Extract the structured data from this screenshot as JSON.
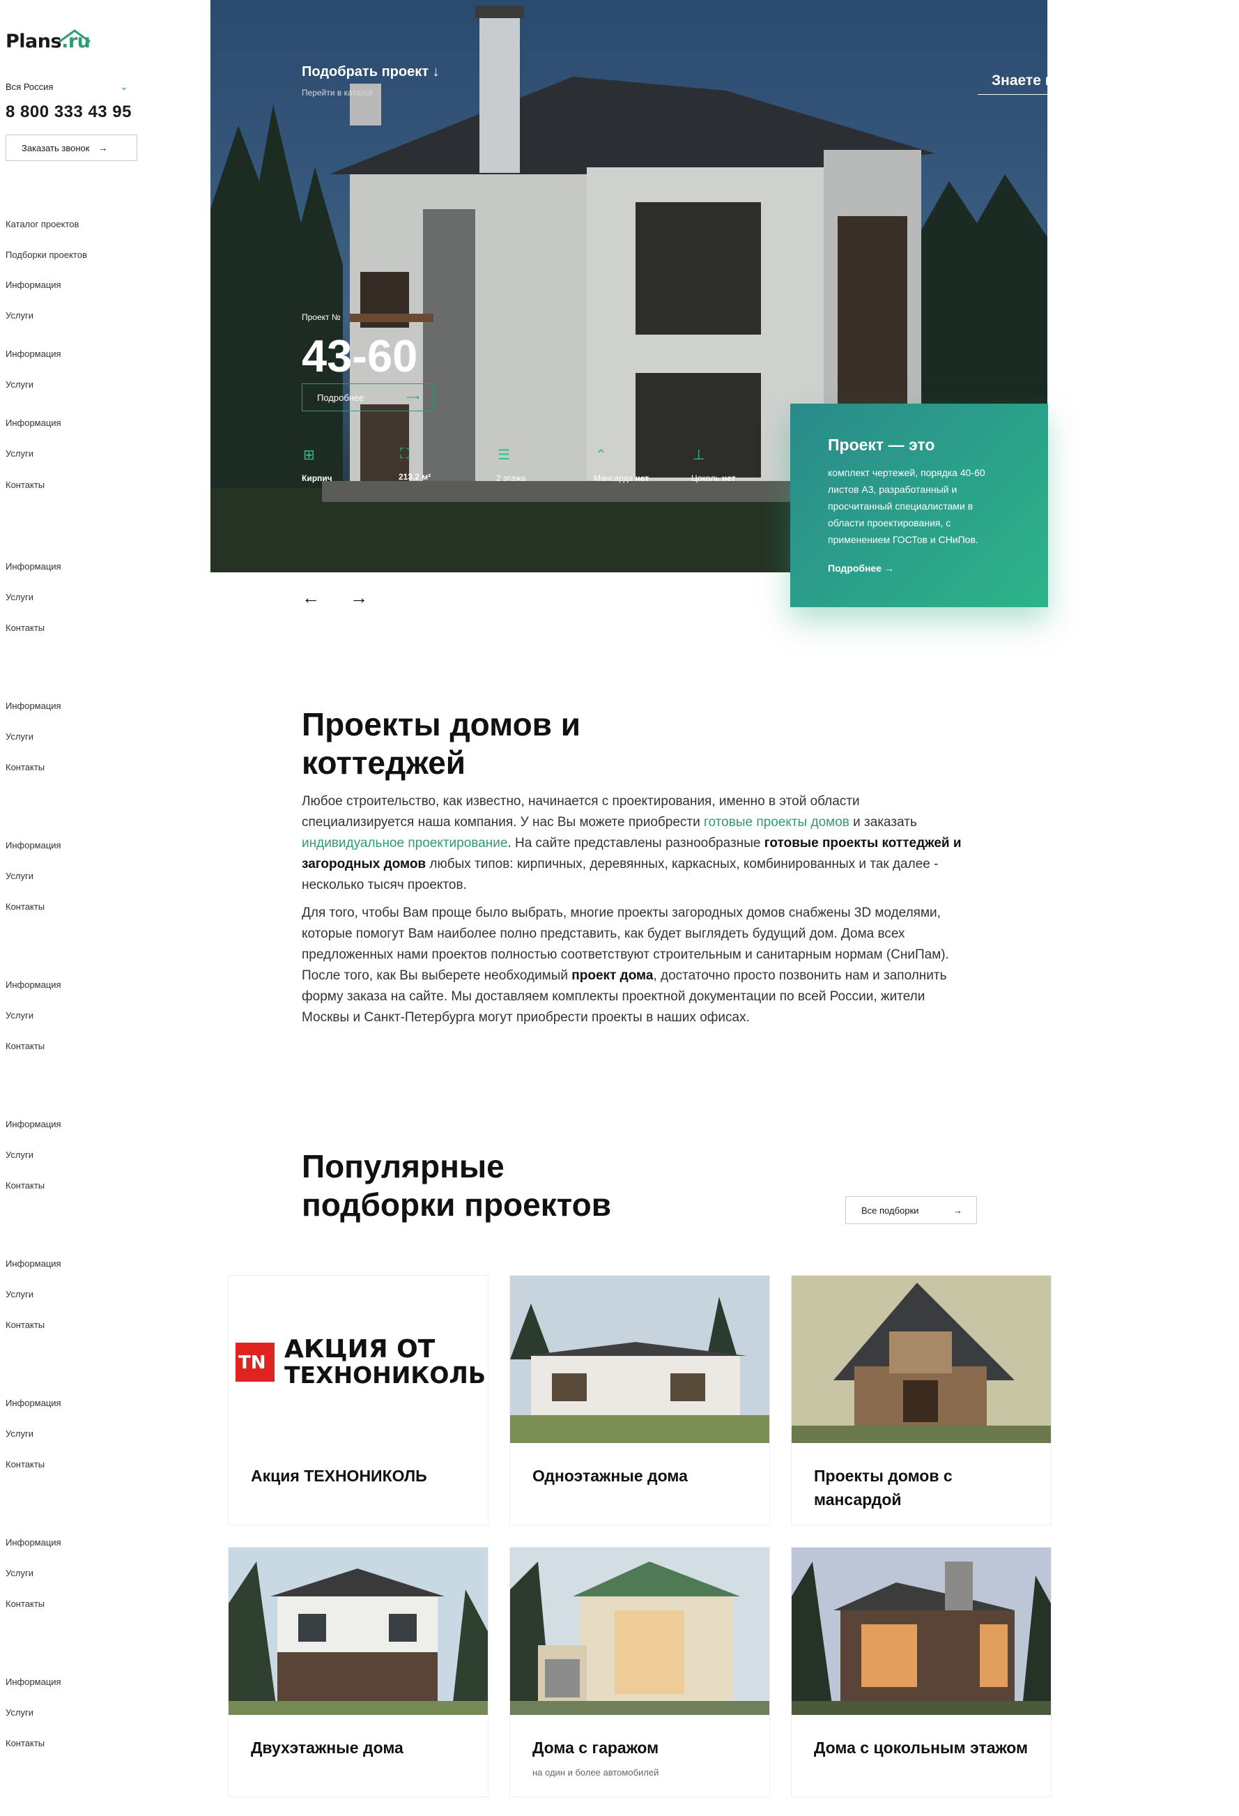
{
  "logo": {
    "text_main": "Plans",
    "text_dot": ".ru"
  },
  "sidebar": {
    "region": "Вся Россия",
    "phone": "8 800 333 43 95",
    "callback_label": "Заказать звонок",
    "nav": [
      "Каталог проектов",
      "Подборки проектов",
      "Информация",
      "Услуги",
      "Информация",
      "Услуги",
      "Информация",
      "Услуги",
      "Контакты",
      "Информация",
      "Услуги",
      "Контакты",
      "Информация",
      "Услуги",
      "Контакты",
      "Информация",
      "Услуги",
      "Контакты",
      "Информация",
      "Услуги",
      "Контакты",
      "Информация",
      "Услуги",
      "Контакты",
      "Информация",
      "Услуги",
      "Контакты",
      "Информация",
      "Услуги",
      "Контакты",
      "Информация",
      "Услуги",
      "Контакты",
      "Информация",
      "Услуги",
      "Контакты"
    ]
  },
  "hero": {
    "pick_title": "Подобрать проект",
    "pick_arrow": "↓",
    "pick_sub": "Перейти в каталог",
    "search_placeholder": "Знаете код проекта?",
    "project_label": "Проект №",
    "project_number": "43-60",
    "more_label": "Подробнее",
    "features": [
      {
        "icon": "wall-icon",
        "label": "Кирпич",
        "value": ""
      },
      {
        "icon": "area-icon",
        "label": "213.2 м²",
        "value": ""
      },
      {
        "icon": "floors-icon",
        "label": "2 этажа",
        "value": ""
      },
      {
        "icon": "attic-icon",
        "label": "Мансарда",
        "value": "нет"
      },
      {
        "icon": "basement-icon",
        "label": "Цоколь",
        "value": "нет"
      }
    ],
    "card": {
      "title": "Проект — это",
      "text": "комплект чертежей, порядка 40-60 листов А3, разработанный и просчитанный специалистами в области проектирования, с применением ГОСТов и СНиПов.",
      "more_label": "Подробнее"
    }
  },
  "about": {
    "title_line1": "Проекты домов и",
    "title_line2": "коттеджей",
    "p1_a": "Любое строительство, как известно, начинается с проектирования, именно в этой области специализируется наша компания. У нас Вы можете приобрести ",
    "p1_link1": "готовые проекты домов",
    "p1_b": " и заказать ",
    "p1_link2": "индивидуальное проектирование",
    "p1_c": ". На сайте представлены разнообразные ",
    "p1_bold": "готовые проекты коттеджей и загородных домов",
    "p1_d": " любых типов: кирпичных, деревянных, каркасных, комбинированных и так далее - несколько тысяч проектов.",
    "p2_a": "Для того, чтобы Вам проще было выбрать, многие проекты загородных домов снабжены 3D моделями, которые помогут Вам наиболее полно представить, как будет выглядеть будущий дом. Дома всех предложенных нами проектов полностью соответствуют строительным и санитарным нормам (СниПам). После того, как Вы выберете необходимый ",
    "p2_bold": "проект дома",
    "p2_b": ", достаточно просто позвонить нам и заполнить форму заказа на сайте. Мы доставляем комплекты проектной документации по всей России, жители Москвы и Санкт-Петербурга могут приобрести проекты в наших офисах."
  },
  "popular": {
    "title_line1": "Популярные",
    "title_line2": "подборки проектов",
    "all_label": "Все подборки",
    "promo_line1": "АКЦИЯ ОТ",
    "promo_line2": "ТЕХНОНИКОЛЬ",
    "promo_badge": "TN",
    "tiles": [
      {
        "title": "Акция ТЕХНОНИКОЛЬ",
        "sub": ""
      },
      {
        "title": "Одноэтажные дома",
        "sub": ""
      },
      {
        "title": "Проекты домов с мансардой",
        "sub": ""
      },
      {
        "title": "Двухэтажные дома",
        "sub": ""
      },
      {
        "title": "Дома с гаражом",
        "sub": "на один и более автомобилей"
      },
      {
        "title": "Дома с цокольным этажом",
        "sub": ""
      }
    ]
  },
  "colors": {
    "accent": "#2e9b72",
    "card_from": "#2a8a8a",
    "card_to": "#2cb489"
  }
}
